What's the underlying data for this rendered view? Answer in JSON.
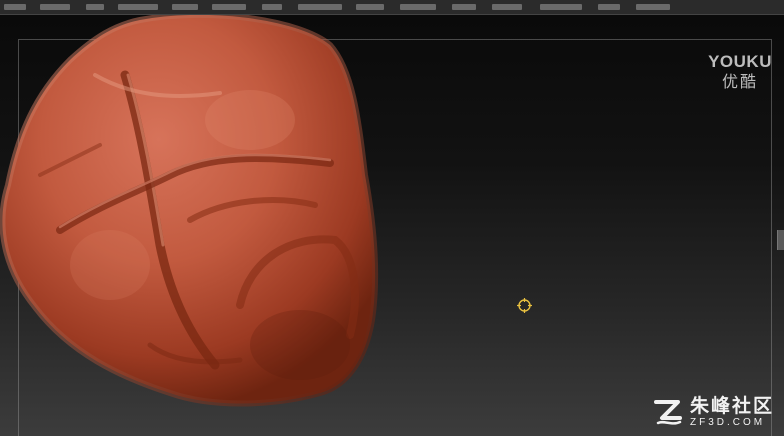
{
  "watermarks": {
    "youku_en": "YOUKU",
    "youku_cn": "优酷",
    "site_cn": "朱峰社区",
    "site_en": "ZF3D.COM"
  },
  "icons": {
    "cursor": "brush-cursor-icon",
    "site_logo": "zf-logo-icon"
  },
  "colors": {
    "model": "#b5482e",
    "background_top": "#0a0a0a",
    "background_bottom": "#3c3c3c",
    "cursor": "#e8c040"
  }
}
